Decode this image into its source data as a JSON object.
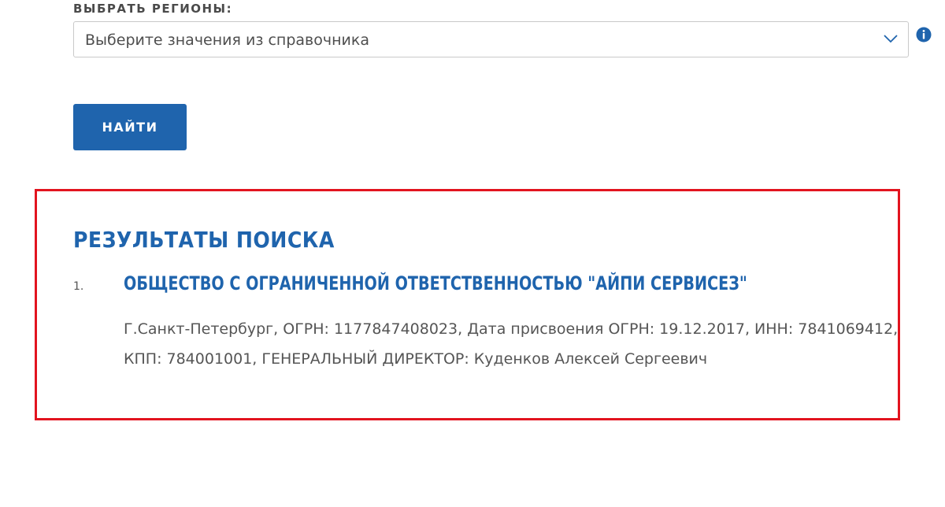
{
  "filters": {
    "regions_label": "ВЫБРАТЬ РЕГИОНЫ:",
    "regions_placeholder": "Выберите значения из справочника"
  },
  "actions": {
    "find_label": "НАЙТИ"
  },
  "results": {
    "title": "РЕЗУЛЬТАТЫ ПОИСКА",
    "items": [
      {
        "number": "1.",
        "name": "ОБЩЕСТВО С ОГРАНИЧЕННОЙ ОТВЕТСТВЕННОСТЬЮ \"АЙПИ СЕРВИСЕЗ\"",
        "details_line1": "Г.Санкт-Петербург, ОГРН: 1177847408023, Дата присвоения ОГРН: 19.12.2017, ИНН: 7841069412,",
        "details_line2": "КПП: 784001001, ГЕНЕРАЛЬНЫЙ ДИРЕКТОР: Куденков Алексей Сергеевич"
      }
    ]
  },
  "icons": {
    "dropdown": "chevron-down-icon",
    "info": "info-icon"
  },
  "colors": {
    "accent": "#1f64ad",
    "highlight_frame": "#e2141f",
    "text": "#555555"
  }
}
